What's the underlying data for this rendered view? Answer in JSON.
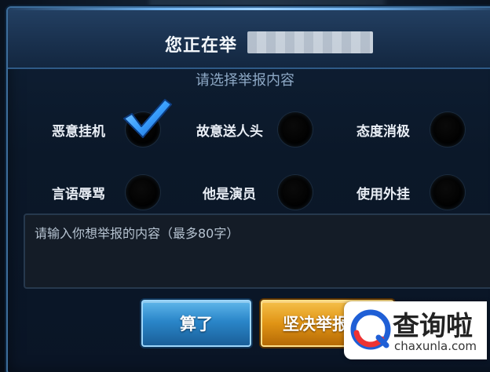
{
  "dialog": {
    "title": "您正在举",
    "subtitle": "请选择举报内容"
  },
  "options": [
    {
      "label": "恶意挂机",
      "checked": true
    },
    {
      "label": "故意送人头",
      "checked": false
    },
    {
      "label": "态度消极",
      "checked": false
    },
    {
      "label": "言语辱骂",
      "checked": false
    },
    {
      "label": "他是演员",
      "checked": false
    },
    {
      "label": "使用外挂",
      "checked": false
    }
  ],
  "report_input": {
    "placeholder": "请输入你想举报的内容（最多80字）",
    "value": ""
  },
  "buttons": {
    "cancel_label": "算了",
    "confirm_label": "坚决举报"
  },
  "watermark": {
    "name": "查询啦",
    "url": "chaxunla.com"
  },
  "colors": {
    "accent_blue": "#2a86c9",
    "accent_gold": "#e09415",
    "check_blue": "#3aa0ff"
  },
  "icons": {
    "check": "checkmark-icon",
    "radio": "radio-circle-icon",
    "watermark_logo": "search-q-logo-icon"
  }
}
